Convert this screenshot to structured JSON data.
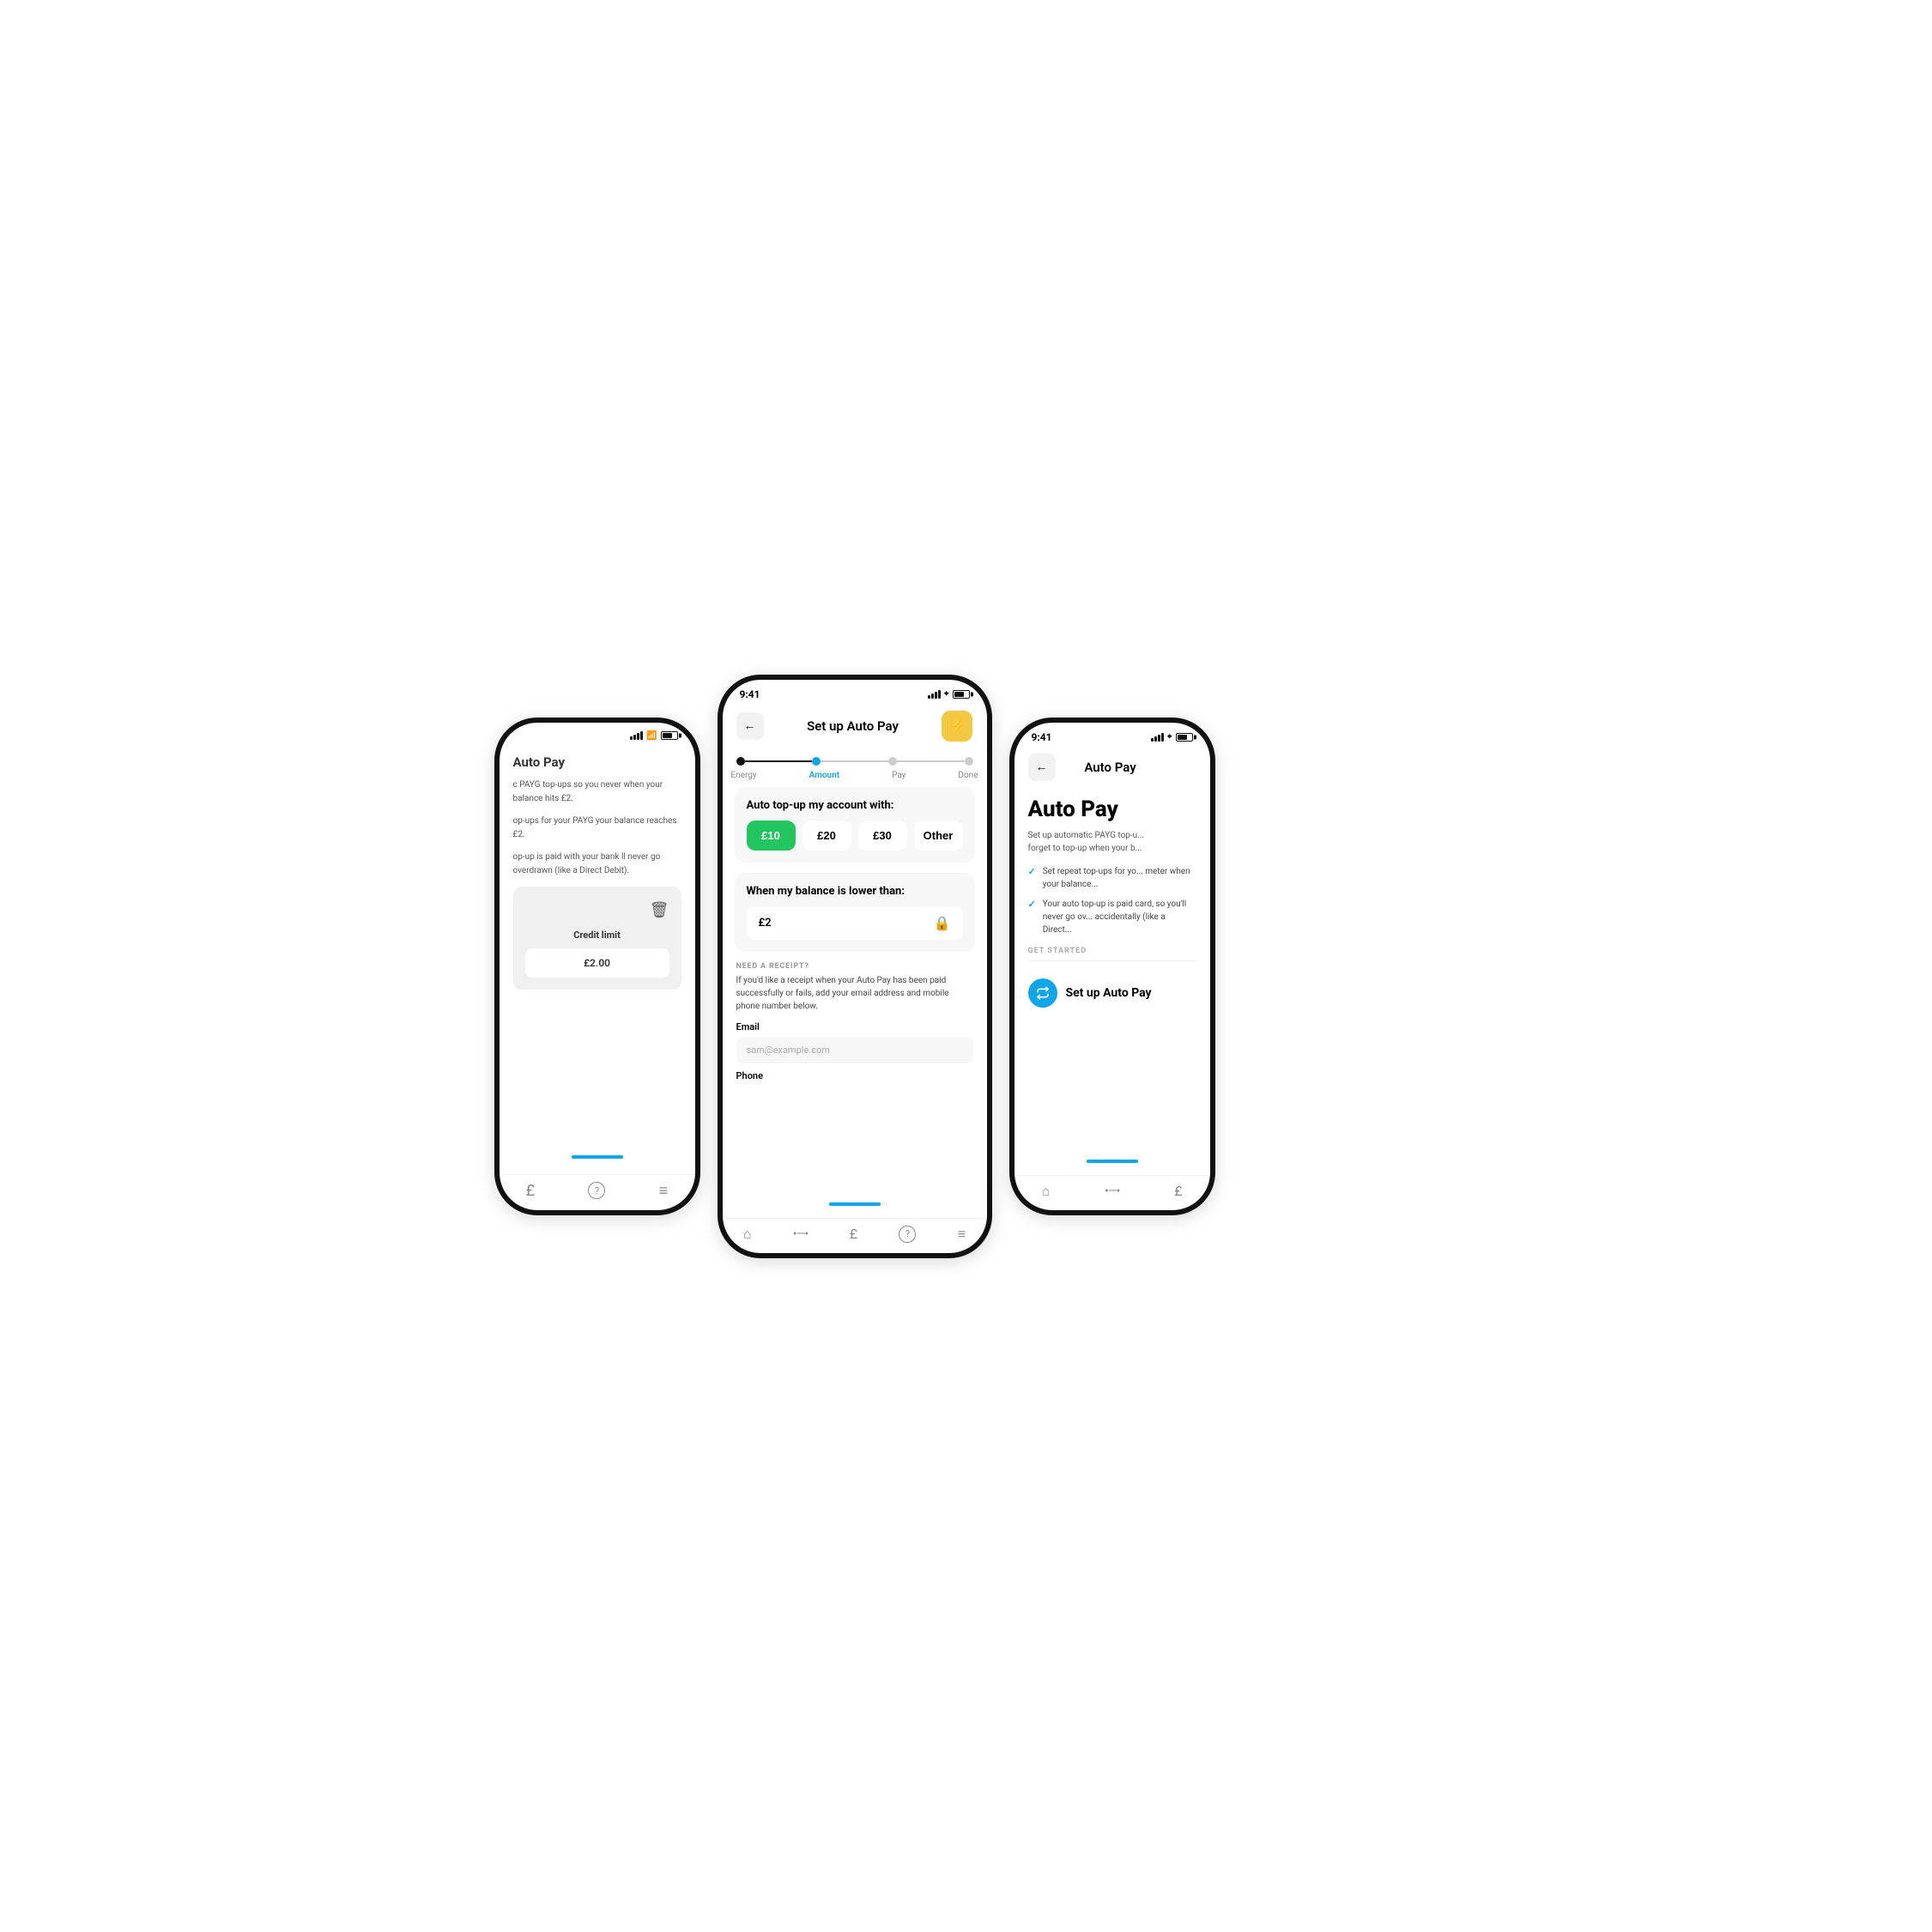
{
  "phones": {
    "left": {
      "title": "Auto Pay",
      "desc1": "c PAYG top-ups so you never when your balance hits £2.",
      "desc2": "op-ups for your PAYG your balance reaches £2.",
      "desc3": "op-up is paid with your bank ll never go overdrawn (like a Direct Debit).",
      "credit_limit_label": "Credit limit",
      "credit_value": "£2.00",
      "nav_icons": [
        "£",
        "?",
        "≡"
      ],
      "trash_icon": "🗑"
    },
    "center": {
      "time": "9:41",
      "nav_back": "←",
      "nav_title": "Set up Auto Pay",
      "nav_action": "⚡",
      "stepper": {
        "steps": [
          "Energy",
          "Amount",
          "Pay",
          "Done"
        ],
        "active": 1
      },
      "card1_title": "Auto top-up my account with:",
      "amounts": [
        "£10",
        "£20",
        "£30",
        "Other"
      ],
      "selected_amount": 0,
      "card2_title": "When my balance is lower than:",
      "balance_value": "£2",
      "receipt_label": "NEED A RECEIPT?",
      "receipt_desc": "If you'd like a receipt when your Auto Pay has been paid successfully or fails, add your email address and mobile phone number below.",
      "email_label": "Email",
      "email_placeholder": "sam@example.com",
      "phone_label": "Phone",
      "nav_icons": [
        "🏠",
        "⋯",
        "£",
        "?",
        "≡"
      ]
    },
    "right": {
      "time": "9:41",
      "nav_back": "←",
      "nav_title": "Auto Pay",
      "autopay_title": "Auto Pay",
      "autopay_desc": "Set up automatic PAYG top-u... forget to top-up when your b...",
      "check_items": [
        "Set repeat top-ups for yo... meter when your balance...",
        "Your auto top-up is paid card, so you'll never go ov... accidentally (like a Direct..."
      ],
      "get_started_label": "GET STARTED",
      "cta_label": "Set up Auto Pay",
      "nav_icons": [
        "🏠",
        "⋯",
        "£"
      ]
    }
  }
}
